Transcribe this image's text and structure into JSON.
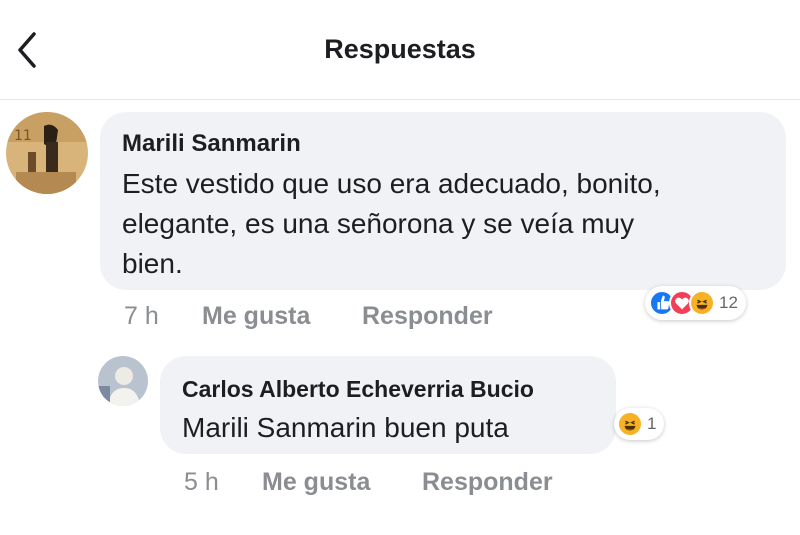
{
  "header": {
    "title": "Respuestas"
  },
  "comment": {
    "author": "Marili Sanmarin",
    "lines": [
      "Este vestido que uso era adecuado, bonito,",
      "elegante, es una señorona y se veía muy",
      "bien."
    ],
    "time": "7 h",
    "like_label": "Me gusta",
    "reply_label": "Responder",
    "reactions": {
      "icons": [
        "like-icon",
        "love-icon",
        "haha-icon"
      ],
      "count": "12"
    }
  },
  "reply": {
    "author": "Carlos Alberto Echeverria Bucio",
    "text": "Marili Sanmarin buen puta",
    "time": "5 h",
    "like_label": "Me gusta",
    "reply_label": "Responder",
    "reactions": {
      "icons": [
        "haha-icon"
      ],
      "count": "1"
    }
  },
  "colors": {
    "bubble": "#f0f2f5",
    "meta_text": "#8a8d91",
    "like_blue": "#1877f2",
    "love_red": "#f33e58",
    "haha_yellow": "#f7b125"
  }
}
